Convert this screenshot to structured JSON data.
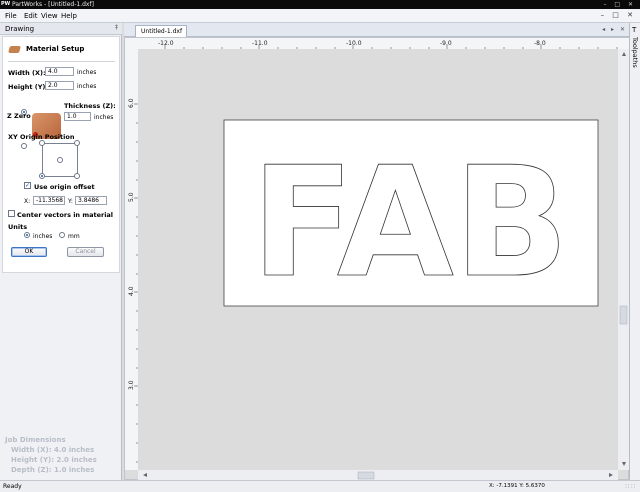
{
  "window": {
    "app_icon": "PW",
    "title": "PartWorks - [Untitled-1.dxf]",
    "controls": "– □ ✕"
  },
  "menu": {
    "items": [
      "File",
      "Edit",
      "View",
      "Help"
    ],
    "doc_controls": "– □ ✕"
  },
  "drawing_panel": {
    "title": "Drawing",
    "pin": "‡"
  },
  "material_setup": {
    "title": "Material Setup",
    "width_label": "Width (X):",
    "width_value": "4.0",
    "width_unit": "inches",
    "height_label": "Height (Y):",
    "height_value": "2.0",
    "height_unit": "inches",
    "thickness_label": "Thickness (Z):",
    "thickness_value": "1.0",
    "thickness_unit": "inches",
    "z_zero_label": "Z Zero",
    "origin_label": "XY Origin Position",
    "use_origin_offset_label": "Use origin offset",
    "use_origin_offset_checked": "✓",
    "x_label": "X:",
    "x_value": "-11.3568",
    "y_label": "Y:",
    "y_value": "3.8486",
    "center_vectors_label": "Center vectors in material",
    "units_label": "Units",
    "unit_inches": "inches",
    "unit_mm": "mm",
    "ok_label": "OK",
    "cancel_label": "Cancel"
  },
  "job_dimensions": {
    "title": "Job Dimensions",
    "width": "Width  (X): 4.0 inches",
    "height": "Height (Y): 2.0 inches",
    "depth": "Depth  (Z): 1.0 inches"
  },
  "tabs": {
    "document": "Untitled-1.dxf",
    "nav": "◂ ▸ ✕"
  },
  "ruler": {
    "h_labels": [
      "-12.0",
      "-11.0",
      "-10.0",
      "-9.0",
      "-8.0"
    ],
    "v_labels": [
      "6.0",
      "5.0",
      "4.0",
      "3.0"
    ]
  },
  "artwork": {
    "text": "FAB"
  },
  "toolpaths": {
    "label": "Toolpaths",
    "icon": "T"
  },
  "status": {
    "ready": "Ready",
    "coords": "X: -7.1391 Y: 5.6370",
    "grip": "∷∷"
  },
  "colors": {
    "accent": "#3f73c6",
    "material_block": "#c4824f",
    "origin_marker": "#c0241d"
  }
}
